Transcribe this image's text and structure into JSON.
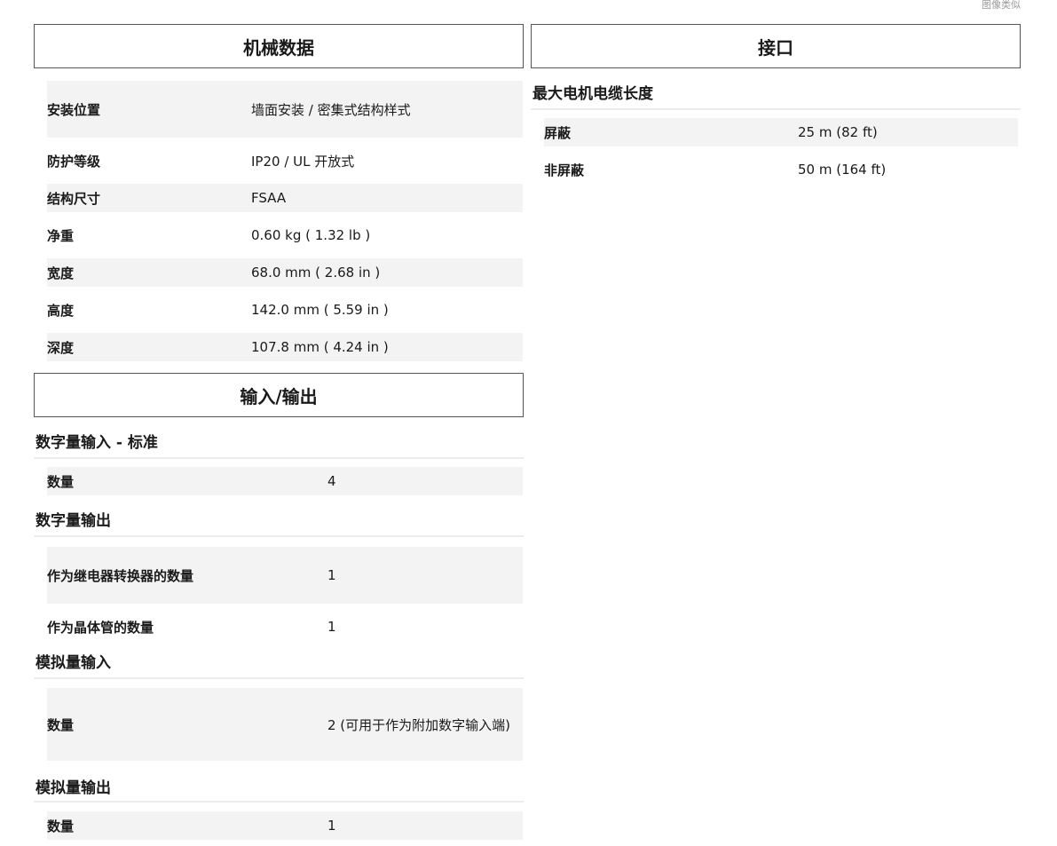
{
  "top_note": "图像类似",
  "left": {
    "mechanical": {
      "title": "机械数据",
      "rows": [
        {
          "label": "安装位置",
          "value": "墙面安装 / 密集式结构样式"
        },
        {
          "label": "防护等级",
          "value": "IP20 / UL 开放式"
        },
        {
          "label": "结构尺寸",
          "value": "FSAA"
        },
        {
          "label": "净重",
          "value": "0.60 kg ( 1.32 lb )"
        },
        {
          "label": "宽度",
          "value": "68.0 mm ( 2.68 in )"
        },
        {
          "label": "高度",
          "value": "142.0 mm ( 5.59 in )"
        },
        {
          "label": "深度",
          "value": "107.8 mm ( 4.24 in )"
        }
      ]
    },
    "io": {
      "title": "输入/输出",
      "groups": [
        {
          "heading": "数字量输入 - 标准",
          "rows": [
            {
              "label": "数量",
              "value": "4"
            }
          ]
        },
        {
          "heading": "数字量输出",
          "rows": [
            {
              "label": "作为继电器转换器的数量",
              "value": "1"
            },
            {
              "label": "作为晶体管的数量",
              "value": "1"
            }
          ]
        },
        {
          "heading": "模拟量输入",
          "rows": [
            {
              "label": "数量",
              "value": "2 (可用于作为附加数字输入端)"
            }
          ]
        },
        {
          "heading": "模拟量输出",
          "rows": [
            {
              "label": "数量",
              "value": "1"
            }
          ]
        }
      ]
    }
  },
  "right": {
    "interface": {
      "title": "接口",
      "groups": [
        {
          "heading": "最大电机电缆长度",
          "rows": [
            {
              "label": "屏蔽",
              "value": "25 m (82 ft)"
            },
            {
              "label": "非屏蔽",
              "value": "50 m (164 ft)"
            }
          ]
        }
      ]
    }
  }
}
